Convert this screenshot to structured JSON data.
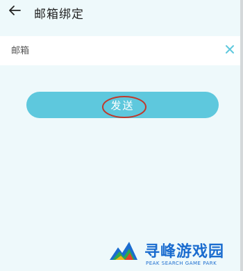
{
  "header": {
    "title": "邮箱绑定",
    "back_icon": "arrow-left-icon"
  },
  "email_field": {
    "placeholder": "邮箱",
    "value": "",
    "clear_icon": "close-icon"
  },
  "send_button": {
    "label": "发送",
    "color": "#5ec8dd"
  },
  "annotation": {
    "highlight_color": "#c0392b"
  },
  "watermark": {
    "name": "寻峰游戏园",
    "tagline": "PEAK SEARCH GAME PARK",
    "color": "#1a6ccf"
  }
}
